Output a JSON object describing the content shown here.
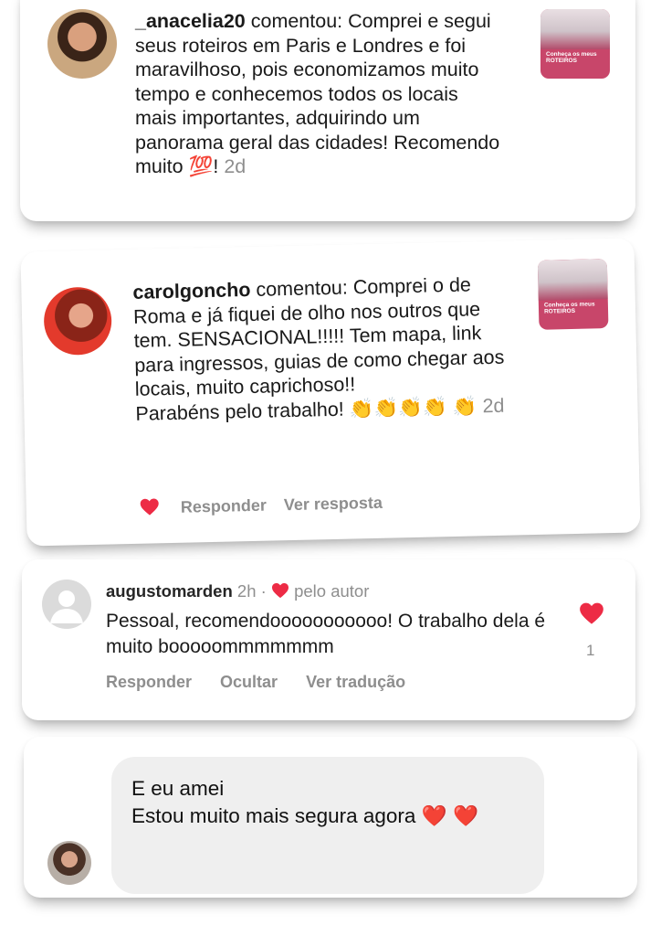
{
  "comments": [
    {
      "username": "_anacelia20",
      "verb": "comentou:",
      "text": "Comprei e segui seus roteiros em Paris e Londres e foi maravilhoso, pois economizamos muito tempo e conhecemos todos os locais mais importantes, adquirindo um panorama geral das cidades! Recomendo muito",
      "emoji": "💯",
      "suffix": "!",
      "time": "2d",
      "post_thumb_caption": "Conheça os meus ROTEIROS"
    },
    {
      "username": "carolgoncho",
      "verb": "comentou:",
      "text": "Comprei o de Roma e já fiquei de olho nos outros que tem. SENSACIONAL!!!!! Tem mapa, link para ingressos, guias de como chegar aos locais, muito caprichoso!!",
      "text2": "Parabéns pelo trabalho!",
      "emoji": "👏👏👏👏",
      "emoji2": "👏",
      "time": "2d",
      "actions": {
        "reply": "Responder",
        "see_reply": "Ver resposta"
      },
      "post_thumb_caption": "Conheça os meus ROTEIROS"
    },
    {
      "username": "augustomarden",
      "time": "2h",
      "separator": "·",
      "liked_by": "pelo autor",
      "text": "Pessoal, recomendooooooooooo! O trabalho dela é muito booooommmmmmm",
      "like_count": "1",
      "actions": {
        "reply": "Responder",
        "hide": "Ocultar",
        "translate": "Ver tradução"
      }
    }
  ],
  "message": {
    "line1": "E eu amei",
    "line2": "Estou muito mais segura agora",
    "emoji": "❤️",
    "emoji2": "❤️"
  },
  "colors": {
    "heart": "#ed2b45",
    "secondary_text": "#8e8e8e",
    "bubble": "#efefef",
    "thumb": "#c8466a"
  }
}
